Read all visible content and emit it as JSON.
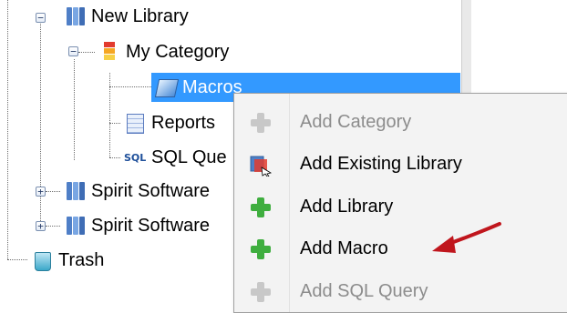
{
  "tree": {
    "items": [
      {
        "label": "New Library",
        "icon": "library-book-icon",
        "expander": "−"
      },
      {
        "label": "My Category",
        "icon": "category-icon",
        "expander": "−"
      },
      {
        "label": "Macros",
        "icon": "macro-icon",
        "selected": true
      },
      {
        "label": "Reports",
        "icon": "report-icon"
      },
      {
        "label": "SQL Que",
        "icon": "sql-icon",
        "icon_text": "SQL"
      },
      {
        "label": "Spirit Software",
        "icon": "library-book-icon",
        "expander": "+"
      },
      {
        "label": "Spirit Software",
        "icon": "library-book-icon",
        "expander": "+"
      },
      {
        "label": "Trash",
        "icon": "trash-icon"
      }
    ]
  },
  "context_menu": {
    "items": [
      {
        "label": "Add Category",
        "icon": "add-plus-icon",
        "disabled": true
      },
      {
        "label": "Add Existing Library",
        "icon": "existing-library-icon",
        "disabled": false
      },
      {
        "label": "Add Library",
        "icon": "add-plus-icon",
        "disabled": false
      },
      {
        "label": "Add Macro",
        "icon": "add-plus-icon",
        "disabled": false
      },
      {
        "label": "Add SQL Query",
        "icon": "add-plus-icon",
        "disabled": true
      }
    ]
  },
  "colors": {
    "selection": "#3399ff",
    "plus_enabled": "#3fae3f",
    "plus_disabled": "#c8c8c8",
    "annotation_arrow": "#c0161d"
  }
}
